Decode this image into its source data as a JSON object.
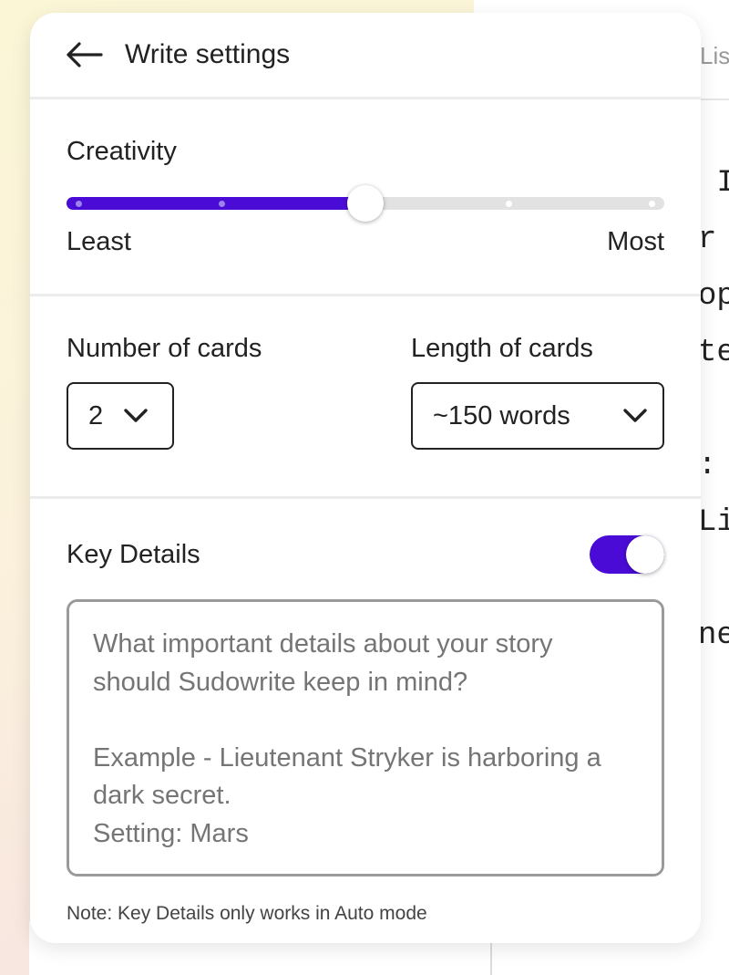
{
  "panel": {
    "title": "Write settings",
    "creativity": {
      "label": "Creativity",
      "min_label": "Least",
      "max_label": "Most",
      "value": 0.5,
      "accent": "#4b0bd6"
    },
    "cards": {
      "number_label": "Number of cards",
      "number_value": "2",
      "length_label": "Length of cards",
      "length_value": "~150 words"
    },
    "key_details": {
      "label": "Key Details",
      "enabled": true,
      "placeholder": "What important details about your story should Sudowrite keep in mind?\n\nExample - Lieutenant Stryker is harboring a dark secret.\nSetting: Mars",
      "note": "Note: Key Details only works in Auto mode"
    }
  },
  "background": {
    "tab_label": "Lis",
    "code_fragments": [
      " I",
      "r",
      "op",
      "te",
      "",
      ":",
      "Li",
      "",
      "ne"
    ]
  },
  "icons": {
    "back": "arrow-left-icon",
    "dropdown": "chevron-down-icon"
  }
}
